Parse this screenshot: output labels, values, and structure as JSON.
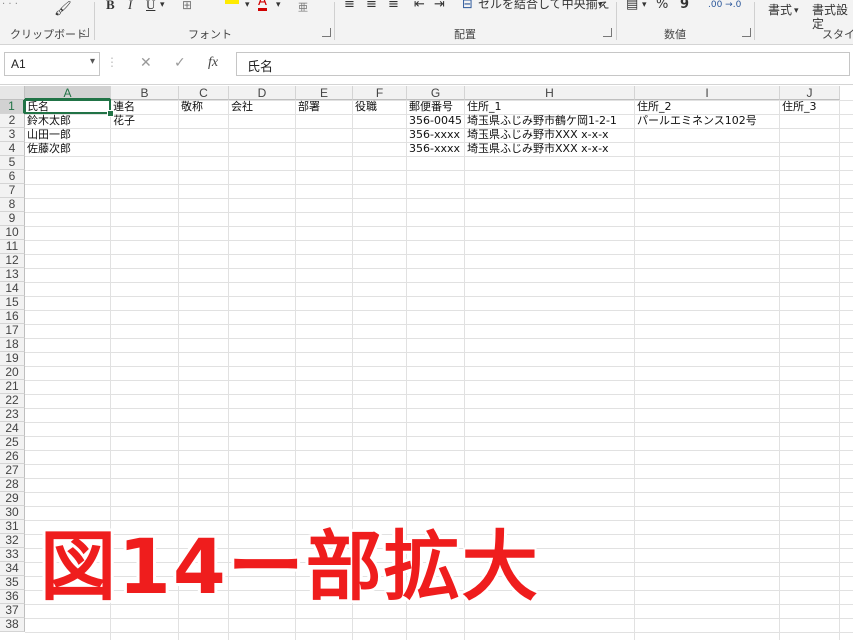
{
  "ribbon": {
    "clipboard_label": "クリップボード",
    "font_label": "フォント",
    "alignment_label": "配置",
    "merge_center_label": "セルを結合して中央揃え",
    "number_label": "数値",
    "styles_label": "スタイル",
    "format_label": "書式",
    "format_settings_label": "書式設定",
    "bold": "B",
    "italic": "I",
    "underline": "U",
    "font_color": "A"
  },
  "formula_bar": {
    "name_box": "A1",
    "cancel": "✕",
    "enter": "✓",
    "fx": "fx",
    "content": "氏名"
  },
  "columns": [
    "A",
    "B",
    "C",
    "D",
    "E",
    "F",
    "G",
    "H",
    "I",
    "J"
  ],
  "rows": [
    "1",
    "2",
    "3",
    "4",
    "5",
    "6",
    "7",
    "8",
    "9",
    "10",
    "11",
    "12",
    "13",
    "14",
    "15",
    "16",
    "17",
    "18",
    "19",
    "20",
    "21",
    "22",
    "23",
    "24",
    "25",
    "26",
    "27",
    "28",
    "29",
    "30",
    "31",
    "32",
    "33",
    "34",
    "35",
    "36",
    "37",
    "38"
  ],
  "selected_cell": "A1",
  "sheet": {
    "row1": [
      "氏名",
      "連名",
      "敬称",
      "会社",
      "部署",
      "役職",
      "郵便番号",
      "住所_1",
      "住所_2",
      "住所_3"
    ],
    "row2": [
      "鈴木太郎",
      "花子",
      "",
      "",
      "",
      "",
      "356-0045",
      "埼玉県ふじみ野市鶴ケ岡1-2-1",
      "パールエミネンス102号",
      ""
    ],
    "row3": [
      "山田一郎",
      "",
      "",
      "",
      "",
      "",
      "356-xxxx",
      "埼玉県ふじみ野市XXX x-x-x",
      "",
      ""
    ],
    "row4": [
      "佐藤次郎",
      "",
      "",
      "",
      "",
      "",
      "356-xxxx",
      "埼玉県ふじみ野市XXX x-x-x",
      "",
      ""
    ]
  },
  "overlay_caption": "図14ー部拡大",
  "colors": {
    "accent": "#217346",
    "caption": "#ef1d1d"
  }
}
